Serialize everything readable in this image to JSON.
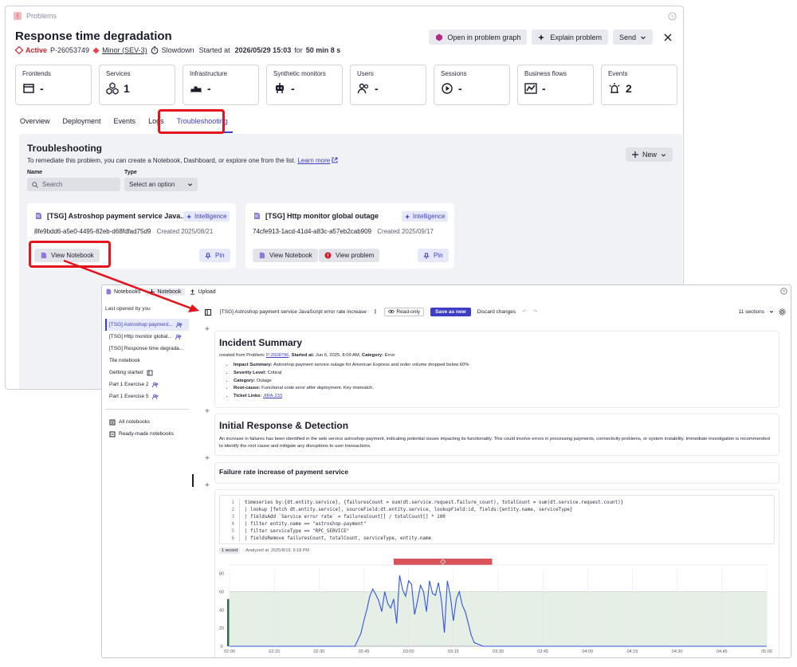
{
  "problem": {
    "app_title": "Problems",
    "title": "Response time degradation",
    "status": "Active",
    "id": "P-26053749",
    "severity": "Minor (SEV-3)",
    "category": "Slowdown",
    "started_prefix": "Started at",
    "started_at": "2026/05/29 15:03",
    "duration_prefix": "for",
    "duration": "50 min 8 s",
    "actions": {
      "graph": "Open in problem graph",
      "explain": "Explain problem",
      "send": "Send"
    },
    "tiles": [
      {
        "label": "Frontends",
        "value": "-",
        "icon": "window-icon"
      },
      {
        "label": "Services",
        "value": "1",
        "icon": "services-icon"
      },
      {
        "label": "Infrastructure",
        "value": "-",
        "icon": "infrastructure-icon"
      },
      {
        "label": "Synthetic monitors",
        "value": "-",
        "icon": "robot-icon"
      },
      {
        "label": "Users",
        "value": "-",
        "icon": "users-icon"
      },
      {
        "label": "Sessions",
        "value": "-",
        "icon": "sessions-icon"
      },
      {
        "label": "Business flows",
        "value": "-",
        "icon": "business-flow-icon"
      },
      {
        "label": "Events",
        "value": "2",
        "icon": "alarm-icon"
      }
    ],
    "tabs": [
      "Overview",
      "Deployment",
      "Events",
      "Logs",
      "Troubleshooting"
    ],
    "active_tab": "Troubleshooting"
  },
  "troubleshooting": {
    "title": "Troubleshooting",
    "description": "To remediate this problem, you can create a Notebook, Dashboard, or explore one from the list.",
    "learn_more": "Learn more",
    "new_label": "New",
    "name_label": "Name",
    "type_label": "Type",
    "search_placeholder": "Search",
    "type_placeholder": "Select an option",
    "cards": [
      {
        "title": "[TSG] Astroshop payment service Java...",
        "badge": "Intelligence",
        "id": "8fe9bdd6-a5e0-4495-82eb-d68fdfad75d9",
        "created": "Created 2025/08/21",
        "btn1": "View Notebook",
        "pin": "Pin"
      },
      {
        "title": "[TSG] Http monitor global outage",
        "badge": "Intelligence",
        "id": "74cfe913-1acd-41d4-a83c-a57eb2cab909",
        "created": "Created 2025/09/17",
        "btn1": "View Notebook",
        "btn2": "View problem",
        "pin": "Pin"
      }
    ]
  },
  "notebook": {
    "top": {
      "notebooks": "Notebooks",
      "new": "Notebook",
      "upload": "Upload"
    },
    "sidebar": {
      "header": "Last opened by you",
      "items": [
        "[TSG] Astroshop payment...",
        "[TSG] Http monitor global...",
        "[TSG] Response time degrada...",
        "Tile notebook",
        "Getting started",
        "Part 1 Exercise 2",
        "Part 1 Exercise 5"
      ],
      "all": "All notebooks",
      "ready": "Ready-made notebooks"
    },
    "toolbar": {
      "title": "[TSG] Astroshop payment service JavaScript error rate increase",
      "readonly": "Read-only",
      "save": "Save as new",
      "discard": "Discard changes",
      "sections": "11 sections"
    },
    "incident": {
      "title": "Incident Summary",
      "created_prefix": "created from Problem:",
      "problem_link": "P-2508796",
      "started_label": "Started at:",
      "started": "Jun 6, 2025, 8:09 AM",
      "category_label": "Category:",
      "category": "Error",
      "bullets": [
        {
          "k": "Impact Summary:",
          "v": "Astroshop payment service outage for American Express and order volume dropped below 60%"
        },
        {
          "k": "Severity Level:",
          "v": "Critical"
        },
        {
          "k": "Category:",
          "v": "Outage"
        },
        {
          "k": "Root-cause:",
          "v": "Functional code error after deployment. Key mismatch."
        },
        {
          "k": "Ticket Links:",
          "v": "JIRA-233"
        }
      ]
    },
    "initial": {
      "title": "Initial Response & Detection",
      "text": "An increase in failures has been identified in the web service astroshop-payment, indicating potential issues impacting its functionality. This could involve errors in processing payments, connectivity problems, or system instability. Immediate investigation is recommended to identify the root cause and mitigate any disruptions to user transactions."
    },
    "failure_title": "Failure rate increase of payment service",
    "code_lines": [
      "timeseries by:{dt.entity.service}, {failuresCount = sum(dt.service.request.failure_count), totalCount = sum(dt.service.request.count)}",
      "| lookup [fetch dt.entity.service], sourceField:dt.entity.service, lookupField:id, fields:{entity.name, serviceType}",
      "| fieldsAdd `Service error rate` = failuresCount[] / totalCount[] * 100",
      "| filter entity.name == \"astroshop-payment\"",
      "| filter serviceType == \"RPC_SERVICE\"",
      "| fieldsRemove failuresCount, totalCount, serviceType, entity.name"
    ],
    "records": "1 record",
    "analyzed": "Analyzed at: 2025/8/19, 9:18 PM"
  },
  "chart_data": {
    "type": "line",
    "x_ticks": [
      "02:00",
      "02:15",
      "02:30",
      "02:45",
      "03:00",
      "03:15",
      "03:30",
      "03:45",
      "04:00",
      "04:15",
      "04:30",
      "04:45",
      "05:00"
    ],
    "y_ticks": [
      0,
      20,
      40,
      60,
      80
    ],
    "ylim": [
      0,
      85
    ],
    "x_range_minutes": [
      0,
      180
    ],
    "threshold": 60,
    "colors": {
      "line": "#3355dd",
      "band": "#e5efe5",
      "problem_bar": "#d9535b",
      "marker": "#2e6e47"
    },
    "series": [
      {
        "x": [
          0,
          42,
          44,
          45,
          46,
          47,
          48,
          49,
          50,
          51,
          52,
          53,
          54,
          55,
          56,
          57,
          58,
          59,
          60,
          61,
          62,
          63,
          64,
          65,
          66,
          67,
          68,
          69,
          70,
          71,
          72,
          73,
          74,
          75,
          76,
          77,
          78,
          79,
          80,
          81,
          82,
          85,
          86,
          180
        ],
        "y": [
          0,
          0,
          14,
          28,
          40,
          55,
          63,
          57,
          50,
          38,
          60,
          47,
          42,
          52,
          25,
          78,
          62,
          55,
          72,
          68,
          35,
          50,
          67,
          60,
          38,
          72,
          58,
          56,
          70,
          50,
          15,
          72,
          55,
          28,
          52,
          60,
          45,
          38,
          25,
          12,
          4,
          0,
          0,
          0
        ]
      }
    ],
    "problem_window_minutes": [
      55,
      88
    ]
  }
}
